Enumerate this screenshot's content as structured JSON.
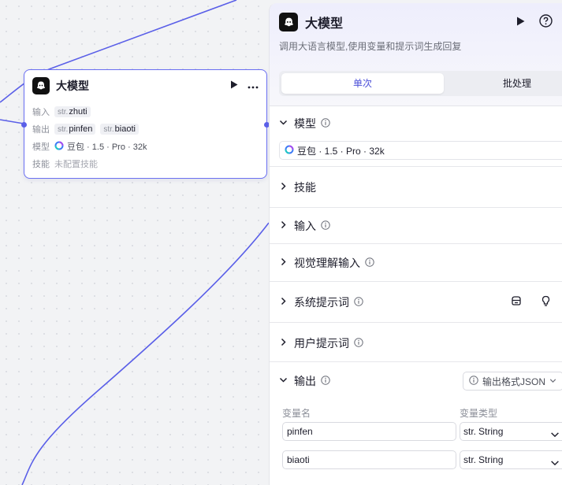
{
  "node": {
    "title": "大模型",
    "input_label": "输入",
    "input_var": "zhuti",
    "output_label": "输出",
    "output_vars": [
      "pinfen",
      "biaoti"
    ],
    "model_label": "模型",
    "model_value": "豆包 · 1.5 · Pro · 32k",
    "skill_label": "技能",
    "skill_value": "未配置技能",
    "var_prefix": "str."
  },
  "panel": {
    "title": "大模型",
    "description": "调用大语言模型,使用变量和提示词生成回复",
    "tabs": [
      {
        "label": "单次",
        "active": true
      },
      {
        "label": "批处理",
        "active": false
      }
    ],
    "sections": {
      "model": {
        "title": "模型",
        "value": "豆包 · 1.5 · Pro · 32k"
      },
      "skills": {
        "title": "技能"
      },
      "input": {
        "title": "输入"
      },
      "vision_input": {
        "title": "视觉理解输入"
      },
      "system_prompt": {
        "title": "系统提示词"
      },
      "user_prompt": {
        "title": "用户提示词"
      },
      "output": {
        "title": "输出",
        "format_button": "输出格式JSON",
        "col_var_name": "变量名",
        "col_var_type": "变量类型",
        "rows": [
          {
            "name": "pinfen",
            "type_prefix": "str.",
            "type": "String"
          },
          {
            "name": "biaoti",
            "type_prefix": "str.",
            "type": "String"
          }
        ]
      }
    }
  },
  "colors": {
    "accent": "#5a5fe8",
    "active_tab_text": "#4b4fd8",
    "node_border": "#6a6ff2",
    "canvas_bg": "#f2f3f5"
  },
  "icons": [
    "logo-icon",
    "play-icon",
    "more-icon",
    "help-icon",
    "chevron-down-icon",
    "chevron-right-icon",
    "info-icon",
    "model-brand-icon",
    "library-icon",
    "bulb-icon"
  ]
}
